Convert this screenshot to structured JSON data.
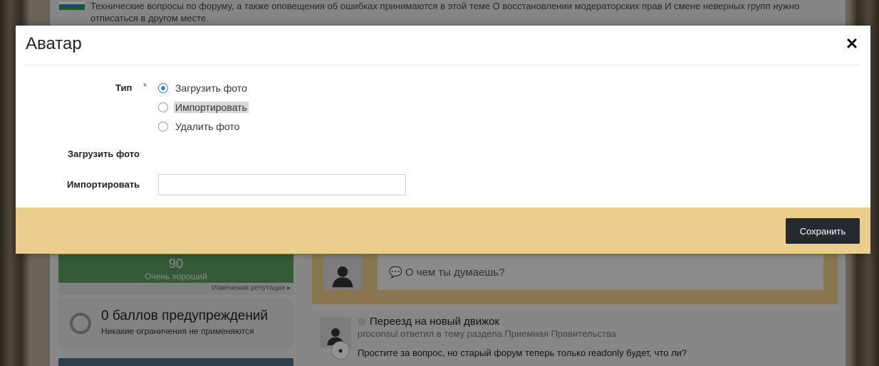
{
  "background": {
    "notice_text": "Технические вопросы по форуму, а также оповещения об ошибках принимаются в этой теме О восстановлении модераторских прав И смене неверных групп нужно отписаться в другом месте.",
    "reputation": {
      "value": "90",
      "label": "Очень хороший",
      "link": "Изменения репутации"
    },
    "warnings": {
      "title": "0 баллов предупреждений",
      "subtitle": "Никакие ограничения не применяются"
    },
    "status_placeholder": "О чем ты думаешь?",
    "feed_item": {
      "title": "Переезд на новый движок",
      "meta": "proconsul ответил в тему раздела Приемная Правительства",
      "body": "Простите за вопрос, но старый форум теперь только readonly будет, что ли?"
    }
  },
  "modal": {
    "title": "Аватар",
    "close_glyph": "✕",
    "type_label": "Тип",
    "required_mark": "*",
    "options": [
      {
        "label": "Загрузить фото",
        "checked": true
      },
      {
        "label": "Импортировать",
        "checked": false
      },
      {
        "label": "Удалить фото",
        "checked": false
      }
    ],
    "upload_label": "Загрузить фото",
    "import_label": "Импортировать",
    "import_value": "",
    "save_label": "Сохранить"
  }
}
